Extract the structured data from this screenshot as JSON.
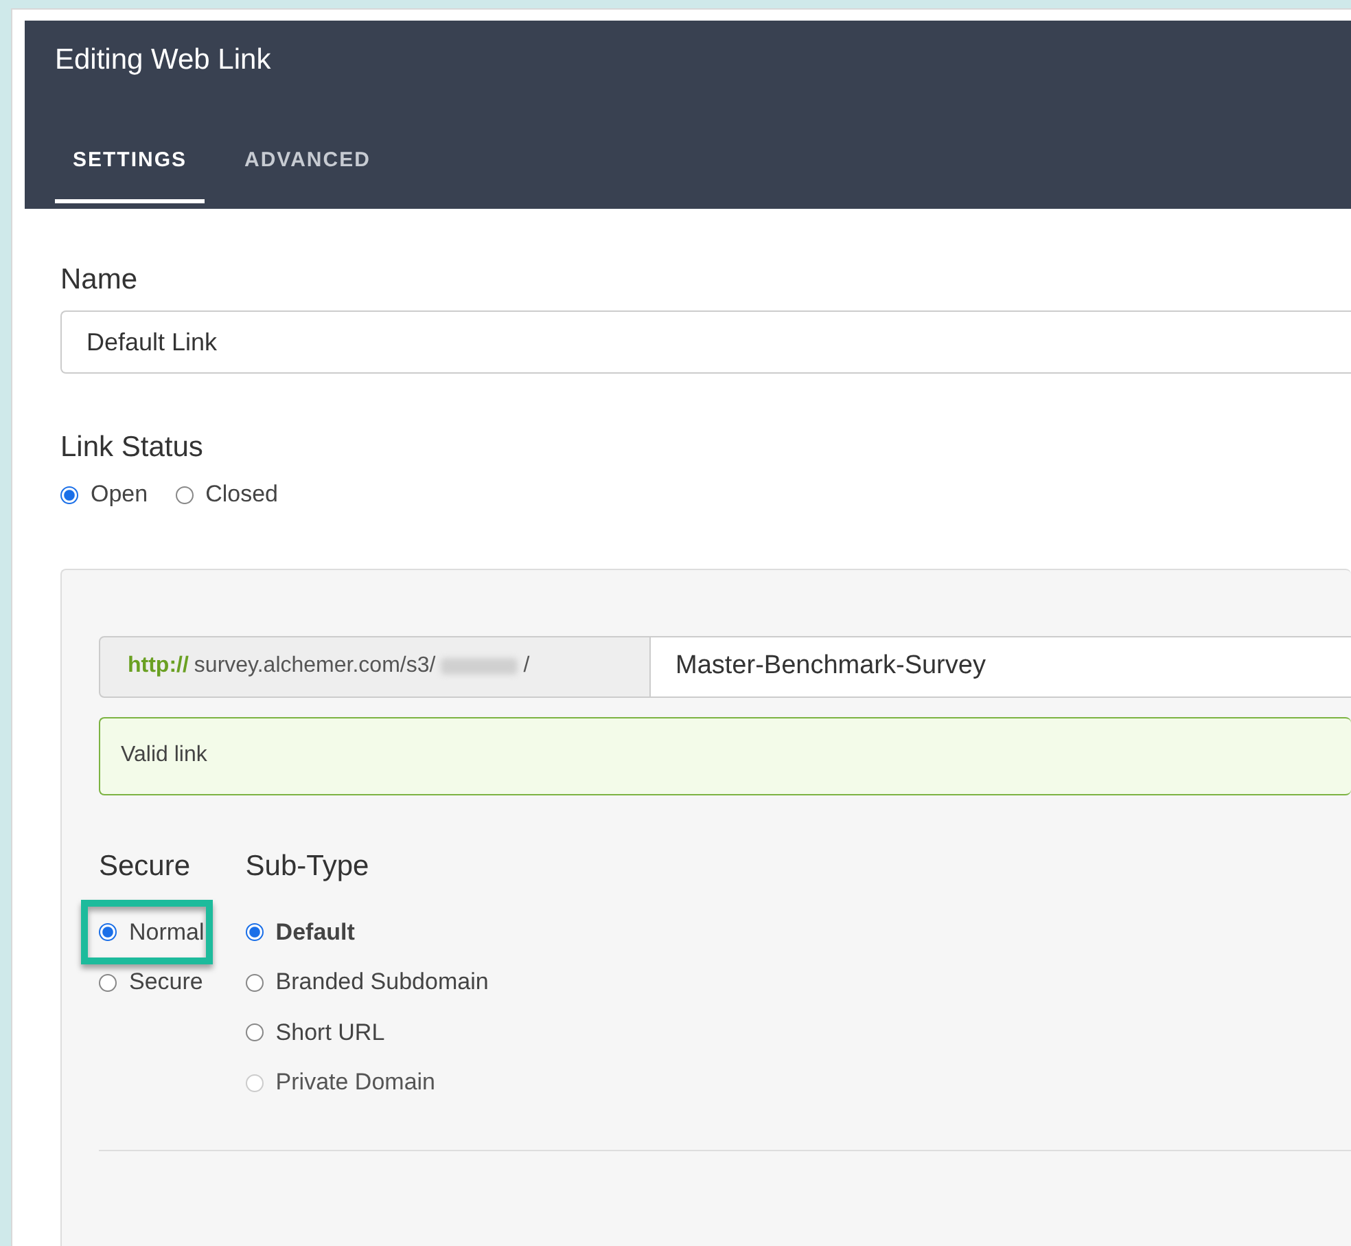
{
  "window": {
    "title": "Editing Web Link"
  },
  "tabs": [
    {
      "label": "SETTINGS",
      "selected": true
    },
    {
      "label": "ADVANCED",
      "selected": false
    }
  ],
  "name_field": {
    "label": "Name",
    "value": "Default Link"
  },
  "link_status": {
    "label": "Link Status",
    "options": [
      {
        "label": "Open",
        "selected": true
      },
      {
        "label": "Closed",
        "selected": false
      }
    ]
  },
  "url": {
    "scheme": "http://",
    "host": "survey.alchemer.com/s3/",
    "suffix": "/",
    "slug": "Master-Benchmark-Survey"
  },
  "validation": {
    "message": "Valid link"
  },
  "groups": [
    {
      "kind": "secure",
      "label": "Secure",
      "options": [
        {
          "label": "Normal",
          "selected": true,
          "disabled": false,
          "highlighted": true
        },
        {
          "label": "Secure",
          "selected": false,
          "disabled": false,
          "highlighted": false
        }
      ]
    },
    {
      "kind": "subtype",
      "label": "Sub-Type",
      "options": [
        {
          "label": "Default",
          "selected": true,
          "disabled": false,
          "highlighted": false
        },
        {
          "label": "Branded Subdomain",
          "selected": false,
          "disabled": false,
          "highlighted": false
        },
        {
          "label": "Short URL",
          "selected": false,
          "disabled": false,
          "highlighted": false
        },
        {
          "label": "Private Domain",
          "selected": false,
          "disabled": true,
          "highlighted": false
        }
      ]
    }
  ]
}
